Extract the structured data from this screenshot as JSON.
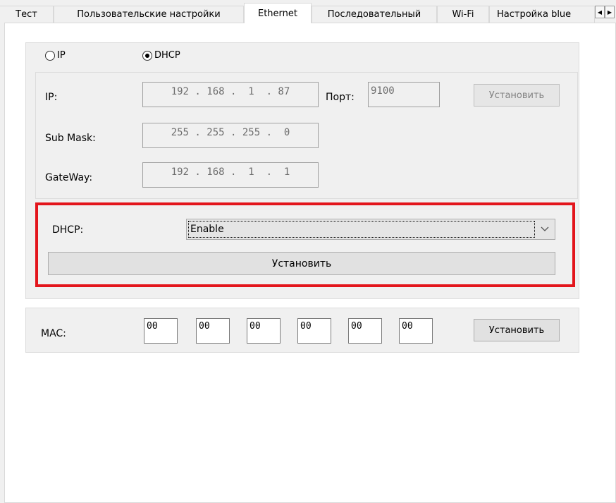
{
  "tabs": [
    {
      "label": "Тест"
    },
    {
      "label": "Пользовательские настройки"
    },
    {
      "label": "Ethernet"
    },
    {
      "label": "Последовательный"
    },
    {
      "label": "Wi-Fi"
    },
    {
      "label": "Настройка blue"
    }
  ],
  "active_tab": "Ethernet",
  "ip_group": {
    "radio_ip_label": "IP",
    "radio_dhcp_label": "DHCP",
    "selected_mode": "DHCP",
    "ip_label": "IP:",
    "ip_value": "192 . 168 .  1  . 87",
    "port_label": "Порт:",
    "port_value": "9100",
    "set_button": "Установить",
    "submask_label": "Sub Mask:",
    "submask_value": "255 . 255 . 255 .  0",
    "gateway_label": "GateWay:",
    "gateway_value": "192 . 168 .  1  .  1"
  },
  "dhcp_group": {
    "label": "DHCP:",
    "selected": "Enable",
    "set_button": "Установить",
    "highlight_color": "#e3151c"
  },
  "mac_group": {
    "label": "MAC:",
    "octets": [
      "00",
      "00",
      "00",
      "00",
      "00",
      "00"
    ],
    "set_button": "Установить"
  }
}
